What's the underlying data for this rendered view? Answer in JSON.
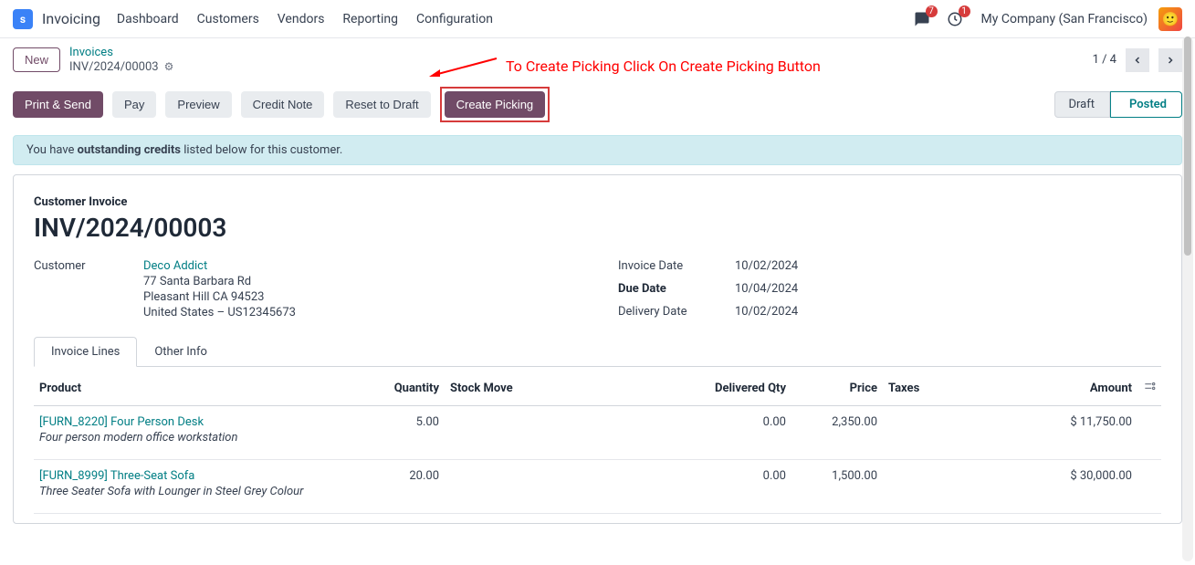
{
  "app": {
    "icon_letter": "s",
    "title": "Invoicing"
  },
  "nav": {
    "items": [
      "Dashboard",
      "Customers",
      "Vendors",
      "Reporting",
      "Configuration"
    ]
  },
  "systray": {
    "messages_badge": "7",
    "activities_badge": "1",
    "company": "My Company (San Francisco)"
  },
  "breadcrumb": {
    "new_button": "New",
    "parent": "Invoices",
    "current": "INV/2024/00003"
  },
  "pager": {
    "text": "1 / 4"
  },
  "actions": {
    "print_send": "Print & Send",
    "pay": "Pay",
    "preview": "Preview",
    "credit_note": "Credit Note",
    "reset_draft": "Reset to Draft",
    "create_picking": "Create Picking"
  },
  "annotation": "To Create Picking Click On Create Picking Button",
  "status": {
    "draft": "Draft",
    "posted": "Posted"
  },
  "banner": {
    "prefix": "You have ",
    "bold": "outstanding credits",
    "suffix": " listed below for this customer."
  },
  "invoice": {
    "heading": "Customer Invoice",
    "name": "INV/2024/00003",
    "customer_label": "Customer",
    "customer_name": "Deco Addict",
    "addr1": "77 Santa Barbara Rd",
    "addr2": "Pleasant Hill CA 94523",
    "addr3": "United States – US12345673",
    "date_label": "Invoice Date",
    "date_val": "10/02/2024",
    "due_label": "Due Date",
    "due_val": "10/04/2024",
    "delivery_label": "Delivery Date",
    "delivery_val": "10/02/2024"
  },
  "tabs": {
    "lines": "Invoice Lines",
    "other": "Other Info"
  },
  "table": {
    "cols": {
      "product": "Product",
      "quantity": "Quantity",
      "stock_move": "Stock Move",
      "delivered": "Delivered Qty",
      "price": "Price",
      "taxes": "Taxes",
      "amount": "Amount"
    },
    "rows": [
      {
        "product": "[FURN_8220] Four Person Desk",
        "desc": "Four person modern office workstation",
        "qty": "5.00",
        "stock_move": "",
        "delivered": "0.00",
        "price": "2,350.00",
        "taxes": "",
        "amount": "$ 11,750.00"
      },
      {
        "product": "[FURN_8999] Three-Seat Sofa",
        "desc": "Three Seater Sofa with Lounger in Steel Grey Colour",
        "qty": "20.00",
        "stock_move": "",
        "delivered": "0.00",
        "price": "1,500.00",
        "taxes": "",
        "amount": "$ 30,000.00"
      }
    ]
  }
}
